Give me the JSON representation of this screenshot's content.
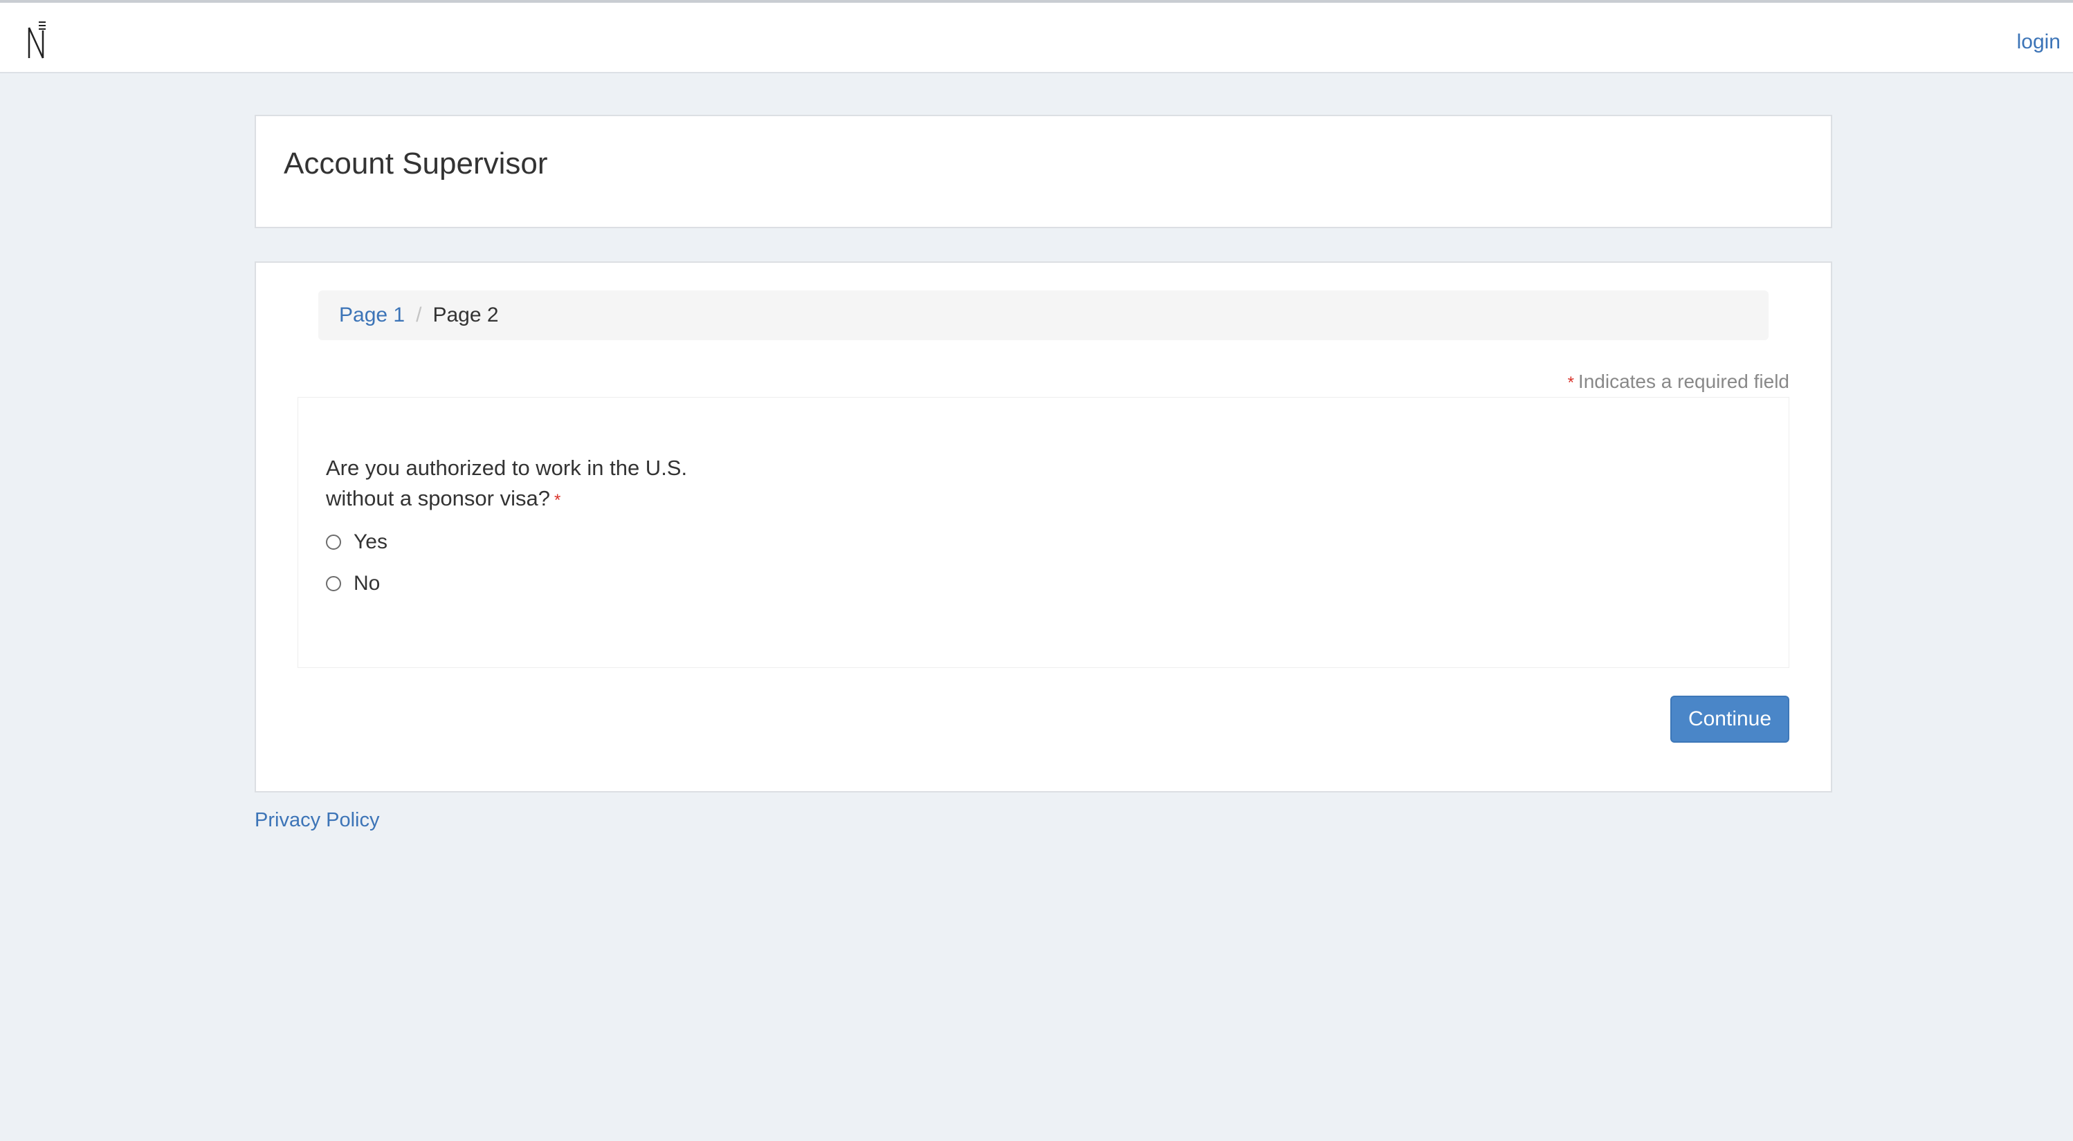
{
  "header": {
    "logo_icon": "n-logo-icon",
    "login_label": "login"
  },
  "title": "Account Supervisor",
  "breadcrumb": {
    "page1": "Page 1",
    "separator": "/",
    "page2": "Page 2"
  },
  "form": {
    "required_star": "*",
    "required_note": "Indicates a required field",
    "question": "Are you authorized to work in the U.S. without a sponsor visa?",
    "options": [
      "Yes",
      "No"
    ],
    "continue_label": "Continue"
  },
  "footer": {
    "privacy_label": "Privacy Policy"
  },
  "colors": {
    "link": "#3c74b7",
    "primary_button": "#4a86c8",
    "required": "#d9332b",
    "background": "#edf1f5"
  }
}
